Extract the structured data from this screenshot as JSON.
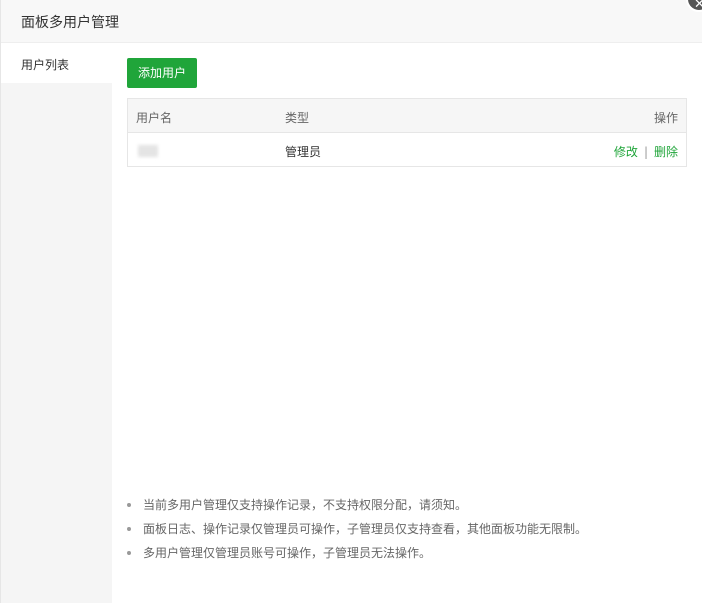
{
  "dialog": {
    "title": "面板多用户管理",
    "close_icon": "close-icon"
  },
  "sidebar": {
    "items": [
      {
        "label": "用户列表",
        "active": true
      }
    ]
  },
  "toolbar": {
    "add_user_label": "添加用户",
    "accent_color": "#20a53a"
  },
  "table": {
    "headers": [
      "用户名",
      "类型",
      "操作"
    ],
    "rows": [
      {
        "username_redacted": true,
        "type": "管理员",
        "actions": {
          "edit": "修改",
          "separator": "|",
          "delete": "删除"
        }
      }
    ]
  },
  "tips": [
    "当前多用户管理仅支持操作记录，不支持权限分配，请须知。",
    "面板日志、操作记录仅管理员可操作，子管理员仅支持查看，其他面板功能无限制。",
    "多用户管理仅管理员账号可操作，子管理员无法操作。"
  ]
}
